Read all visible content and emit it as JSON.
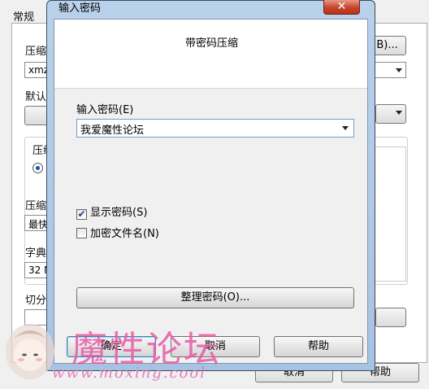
{
  "background_window": {
    "tab_label": "常规",
    "archive_name_label": "压缩",
    "archive_name_value": "xmz.",
    "browse_button": "(B)...",
    "default_label": "默认",
    "compress_option_label": "压缩",
    "radio_label": "",
    "compression_label": "压缩",
    "compression_value": "最快",
    "dictionary_label": "字典",
    "dictionary_value": "32 M",
    "split_label": "切分",
    "bottom_buttons": {
      "cancel": "取消",
      "help": "帮助"
    }
  },
  "dialog": {
    "title": "输入密码",
    "close_label": "✕",
    "heading": "带密码压缩",
    "password_label": "输入密码(E)",
    "password_value": "我爱魔性论坛",
    "show_password_label": "显示密码(S)",
    "show_password_checked": true,
    "encrypt_filenames_label": "加密文件名(N)",
    "encrypt_filenames_checked": false,
    "organize_button": "整理密码(O)...",
    "ok_button": "确定",
    "cancel_button": "取消",
    "help_button": "帮助"
  },
  "watermark": {
    "text": "魔性论坛",
    "url": "www.moxing.cool"
  },
  "icons": {
    "check": "✔",
    "dropdown": "chevron-down-icon"
  }
}
